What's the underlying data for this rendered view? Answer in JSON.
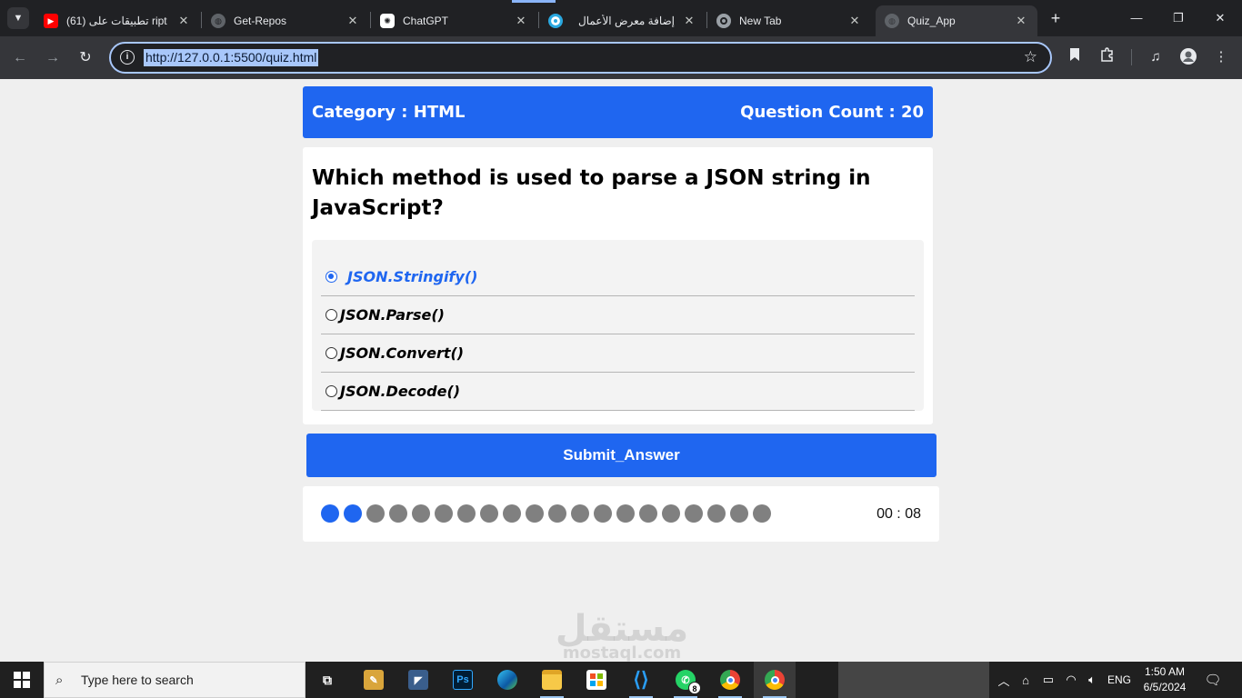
{
  "browser": {
    "tabs": [
      {
        "title": "(61) تطبيقات على ript",
        "favicon": "youtube-icon",
        "active": false
      },
      {
        "title": "Get-Repos",
        "favicon": "globe-icon",
        "active": false
      },
      {
        "title": "ChatGPT",
        "favicon": "chatgpt-icon",
        "active": false
      },
      {
        "title": "إضافة معرض الأعمال",
        "favicon": "mostaql-icon",
        "active": false
      },
      {
        "title": "New Tab",
        "favicon": "chrome-icon",
        "active": false
      },
      {
        "title": "Quiz_App",
        "favicon": "globe-icon",
        "active": true
      }
    ],
    "url": "http://127.0.0.1:5500/quiz.html"
  },
  "quiz": {
    "category_label": "Category : HTML",
    "count_label": "Question Count : 20",
    "question": "Which method is used to parse a JSON string in JavaScript?",
    "answers": [
      {
        "label": "JSON.Stringify()",
        "selected": true
      },
      {
        "label": "JSON.Parse()",
        "selected": false
      },
      {
        "label": "JSON.Convert()",
        "selected": false
      },
      {
        "label": "JSON.Decode()",
        "selected": false
      }
    ],
    "submit_label": "Submit_Answer",
    "progress": {
      "total": 20,
      "completed": 2
    },
    "timer": "00 : 08",
    "accent_color": "#1f66f0"
  },
  "watermark": {
    "arabic": "مستقل",
    "latin": "mostaql.com"
  },
  "taskbar": {
    "search_placeholder": "Type here to search",
    "whatsapp_badge": "8",
    "language": "ENG",
    "time": "1:50 AM",
    "date": "6/5/2024"
  }
}
